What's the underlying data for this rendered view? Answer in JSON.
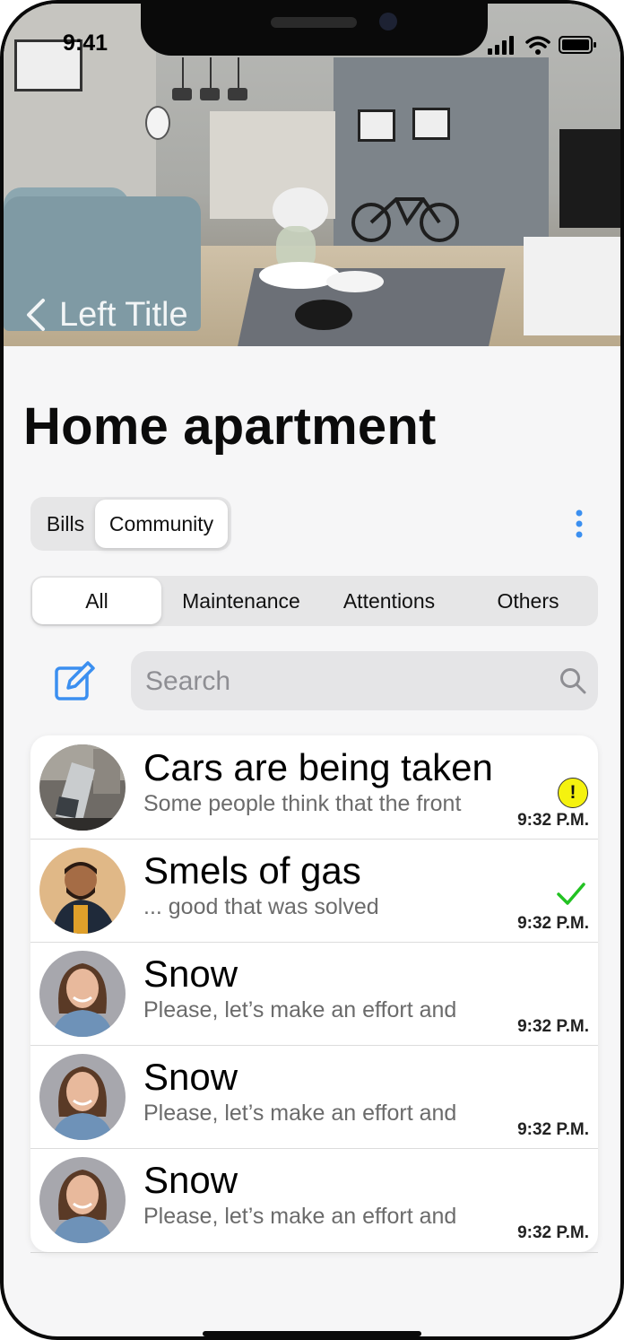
{
  "status": {
    "time": "9:41"
  },
  "header": {
    "back_label": "Left Title",
    "title": "Home apartment"
  },
  "segment": {
    "options": [
      "Bills",
      "Community"
    ],
    "selected": "Community"
  },
  "tabs": {
    "items": [
      "All",
      "Maintenance",
      "Attentions",
      "Others"
    ],
    "selected": "All"
  },
  "search": {
    "placeholder": "Search",
    "value": ""
  },
  "messages": [
    {
      "title": "Cars are being taken",
      "preview": "Some people think that the front",
      "time": "9:32 P.M.",
      "status": "attention",
      "status_mark": "!"
    },
    {
      "title": "Smels of gas",
      "preview": "... good that was solved",
      "time": "9:32 P.M.",
      "status": "resolved"
    },
    {
      "title": "Snow",
      "preview": "Please, let’s make an effort and",
      "time": "9:32 P.M.",
      "status": "none"
    },
    {
      "title": "Snow",
      "preview": "Please, let’s make an effort and",
      "time": "9:32 P.M.",
      "status": "none"
    },
    {
      "title": "Snow",
      "preview": "Please, let’s make an effort and",
      "time": "9:32 P.M.",
      "status": "none"
    }
  ],
  "colors": {
    "accent": "#3b8ff0",
    "alert": "#f5f20f",
    "resolved": "#22c222",
    "background": "#f6f6f7"
  }
}
